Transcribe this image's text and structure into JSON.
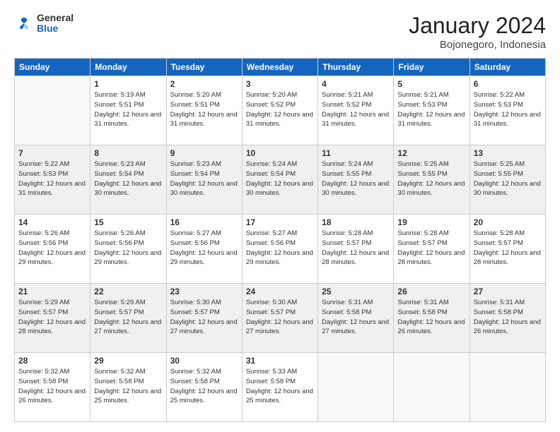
{
  "header": {
    "logo": {
      "general": "General",
      "blue": "Blue"
    },
    "title": "January 2024",
    "subtitle": "Bojonegoro, Indonesia"
  },
  "days_of_week": [
    "Sunday",
    "Monday",
    "Tuesday",
    "Wednesday",
    "Thursday",
    "Friday",
    "Saturday"
  ],
  "weeks": [
    [
      {
        "day": "",
        "empty": true
      },
      {
        "day": "1",
        "sunrise": "Sunrise: 5:19 AM",
        "sunset": "Sunset: 5:51 PM",
        "daylight": "Daylight: 12 hours and 31 minutes."
      },
      {
        "day": "2",
        "sunrise": "Sunrise: 5:20 AM",
        "sunset": "Sunset: 5:51 PM",
        "daylight": "Daylight: 12 hours and 31 minutes."
      },
      {
        "day": "3",
        "sunrise": "Sunrise: 5:20 AM",
        "sunset": "Sunset: 5:52 PM",
        "daylight": "Daylight: 12 hours and 31 minutes."
      },
      {
        "day": "4",
        "sunrise": "Sunrise: 5:21 AM",
        "sunset": "Sunset: 5:52 PM",
        "daylight": "Daylight: 12 hours and 31 minutes."
      },
      {
        "day": "5",
        "sunrise": "Sunrise: 5:21 AM",
        "sunset": "Sunset: 5:53 PM",
        "daylight": "Daylight: 12 hours and 31 minutes."
      },
      {
        "day": "6",
        "sunrise": "Sunrise: 5:22 AM",
        "sunset": "Sunset: 5:53 PM",
        "daylight": "Daylight: 12 hours and 31 minutes."
      }
    ],
    [
      {
        "day": "7",
        "sunrise": "Sunrise: 5:22 AM",
        "sunset": "Sunset: 5:53 PM",
        "daylight": "Daylight: 12 hours and 31 minutes."
      },
      {
        "day": "8",
        "sunrise": "Sunrise: 5:23 AM",
        "sunset": "Sunset: 5:54 PM",
        "daylight": "Daylight: 12 hours and 30 minutes."
      },
      {
        "day": "9",
        "sunrise": "Sunrise: 5:23 AM",
        "sunset": "Sunset: 5:54 PM",
        "daylight": "Daylight: 12 hours and 30 minutes."
      },
      {
        "day": "10",
        "sunrise": "Sunrise: 5:24 AM",
        "sunset": "Sunset: 5:54 PM",
        "daylight": "Daylight: 12 hours and 30 minutes."
      },
      {
        "day": "11",
        "sunrise": "Sunrise: 5:24 AM",
        "sunset": "Sunset: 5:55 PM",
        "daylight": "Daylight: 12 hours and 30 minutes."
      },
      {
        "day": "12",
        "sunrise": "Sunrise: 5:25 AM",
        "sunset": "Sunset: 5:55 PM",
        "daylight": "Daylight: 12 hours and 30 minutes."
      },
      {
        "day": "13",
        "sunrise": "Sunrise: 5:25 AM",
        "sunset": "Sunset: 5:55 PM",
        "daylight": "Daylight: 12 hours and 30 minutes."
      }
    ],
    [
      {
        "day": "14",
        "sunrise": "Sunrise: 5:26 AM",
        "sunset": "Sunset: 5:56 PM",
        "daylight": "Daylight: 12 hours and 29 minutes."
      },
      {
        "day": "15",
        "sunrise": "Sunrise: 5:26 AM",
        "sunset": "Sunset: 5:56 PM",
        "daylight": "Daylight: 12 hours and 29 minutes."
      },
      {
        "day": "16",
        "sunrise": "Sunrise: 5:27 AM",
        "sunset": "Sunset: 5:56 PM",
        "daylight": "Daylight: 12 hours and 29 minutes."
      },
      {
        "day": "17",
        "sunrise": "Sunrise: 5:27 AM",
        "sunset": "Sunset: 5:56 PM",
        "daylight": "Daylight: 12 hours and 29 minutes."
      },
      {
        "day": "18",
        "sunrise": "Sunrise: 5:28 AM",
        "sunset": "Sunset: 5:57 PM",
        "daylight": "Daylight: 12 hours and 28 minutes."
      },
      {
        "day": "19",
        "sunrise": "Sunrise: 5:28 AM",
        "sunset": "Sunset: 5:57 PM",
        "daylight": "Daylight: 12 hours and 28 minutes."
      },
      {
        "day": "20",
        "sunrise": "Sunrise: 5:28 AM",
        "sunset": "Sunset: 5:57 PM",
        "daylight": "Daylight: 12 hours and 28 minutes."
      }
    ],
    [
      {
        "day": "21",
        "sunrise": "Sunrise: 5:29 AM",
        "sunset": "Sunset: 5:57 PM",
        "daylight": "Daylight: 12 hours and 28 minutes."
      },
      {
        "day": "22",
        "sunrise": "Sunrise: 5:29 AM",
        "sunset": "Sunset: 5:57 PM",
        "daylight": "Daylight: 12 hours and 27 minutes."
      },
      {
        "day": "23",
        "sunrise": "Sunrise: 5:30 AM",
        "sunset": "Sunset: 5:57 PM",
        "daylight": "Daylight: 12 hours and 27 minutes."
      },
      {
        "day": "24",
        "sunrise": "Sunrise: 5:30 AM",
        "sunset": "Sunset: 5:57 PM",
        "daylight": "Daylight: 12 hours and 27 minutes."
      },
      {
        "day": "25",
        "sunrise": "Sunrise: 5:31 AM",
        "sunset": "Sunset: 5:58 PM",
        "daylight": "Daylight: 12 hours and 27 minutes."
      },
      {
        "day": "26",
        "sunrise": "Sunrise: 5:31 AM",
        "sunset": "Sunset: 5:58 PM",
        "daylight": "Daylight: 12 hours and 26 minutes."
      },
      {
        "day": "27",
        "sunrise": "Sunrise: 5:31 AM",
        "sunset": "Sunset: 5:58 PM",
        "daylight": "Daylight: 12 hours and 26 minutes."
      }
    ],
    [
      {
        "day": "28",
        "sunrise": "Sunrise: 5:32 AM",
        "sunset": "Sunset: 5:58 PM",
        "daylight": "Daylight: 12 hours and 26 minutes."
      },
      {
        "day": "29",
        "sunrise": "Sunrise: 5:32 AM",
        "sunset": "Sunset: 5:58 PM",
        "daylight": "Daylight: 12 hours and 25 minutes."
      },
      {
        "day": "30",
        "sunrise": "Sunrise: 5:32 AM",
        "sunset": "Sunset: 5:58 PM",
        "daylight": "Daylight: 12 hours and 25 minutes."
      },
      {
        "day": "31",
        "sunrise": "Sunrise: 5:33 AM",
        "sunset": "Sunset: 5:58 PM",
        "daylight": "Daylight: 12 hours and 25 minutes."
      },
      {
        "day": "",
        "empty": true
      },
      {
        "day": "",
        "empty": true
      },
      {
        "day": "",
        "empty": true
      }
    ]
  ]
}
